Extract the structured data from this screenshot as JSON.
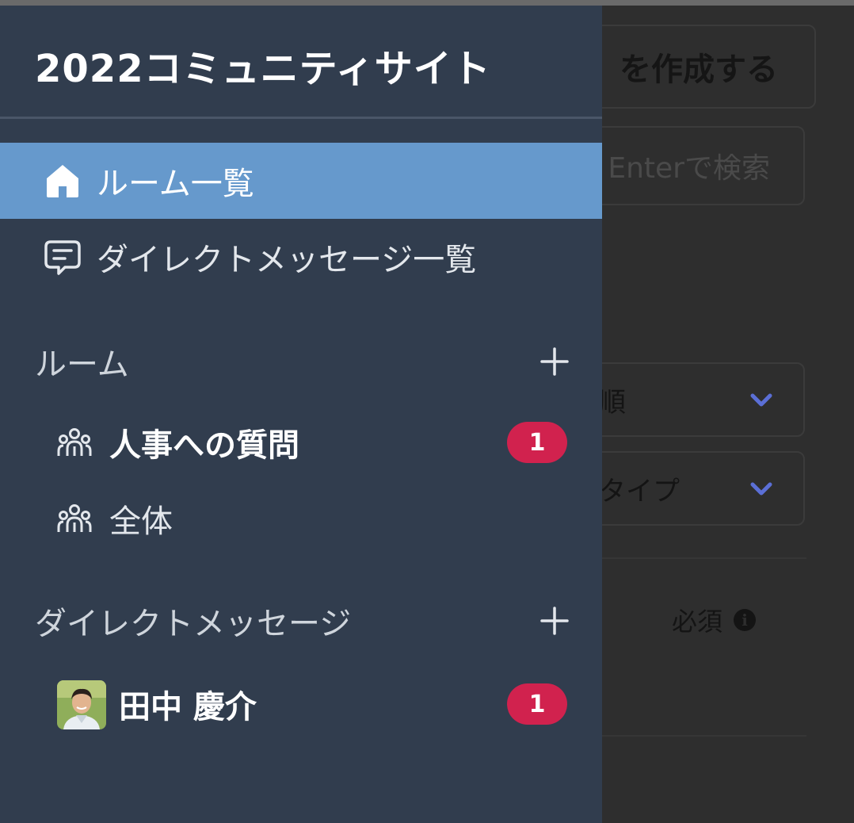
{
  "app": {
    "title": "2022コミュニティサイト"
  },
  "navigation": {
    "items": [
      {
        "label": "ルーム一覧",
        "icon": "home-icon",
        "selected": true
      },
      {
        "label": "ダイレクトメッセージ一覧",
        "icon": "message-icon",
        "selected": false
      }
    ]
  },
  "rooms_section": {
    "header": "ルーム",
    "add_icon": "plus-icon",
    "items": [
      {
        "label": "人事への質問",
        "icon": "group-icon",
        "unread": 1,
        "unread_label": "1"
      },
      {
        "label": "全体",
        "icon": "group-icon"
      }
    ]
  },
  "dm_section": {
    "header": "ダイレクトメッセージ",
    "add_icon": "plus-icon",
    "items": [
      {
        "label": "田中 慶介",
        "icon": "avatar",
        "unread": 1,
        "unread_label": "1"
      }
    ]
  },
  "background_page": {
    "create_button_text": "を作成する",
    "search_placeholder": "Enterで検索",
    "sort_select_text": "順",
    "type_select_text": "タイプ",
    "required_label": "必須",
    "info_icon_glyph": "i"
  },
  "colors": {
    "drawer_bg": "#313d4e",
    "selected_bg": "#6699cc",
    "badge_bg": "#d1224e",
    "chevron": "#5b6fd6"
  }
}
